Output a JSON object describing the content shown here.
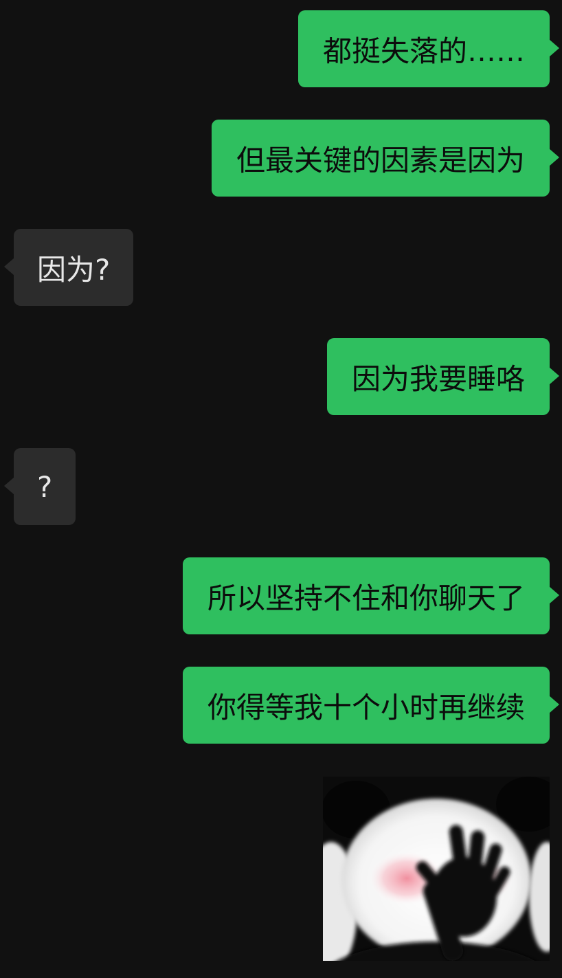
{
  "messages": [
    {
      "side": "sent",
      "text": "都挺失落的……"
    },
    {
      "side": "sent",
      "text": "但最关键的因素是因为"
    },
    {
      "side": "recv",
      "text": "因为?"
    },
    {
      "side": "sent",
      "text": "因为我要睡咯"
    },
    {
      "side": "recv",
      "text": "?"
    },
    {
      "side": "sent",
      "text": "所以坚持不住和你聊天了"
    },
    {
      "side": "sent",
      "text": "你得等我十个小时再继续"
    }
  ],
  "sticker": {
    "icon": "panda-covering-face-sticker"
  },
  "colors": {
    "background": "#111111",
    "sent_bubble": "#2fbf5f",
    "received_bubble": "#2c2c2c"
  }
}
